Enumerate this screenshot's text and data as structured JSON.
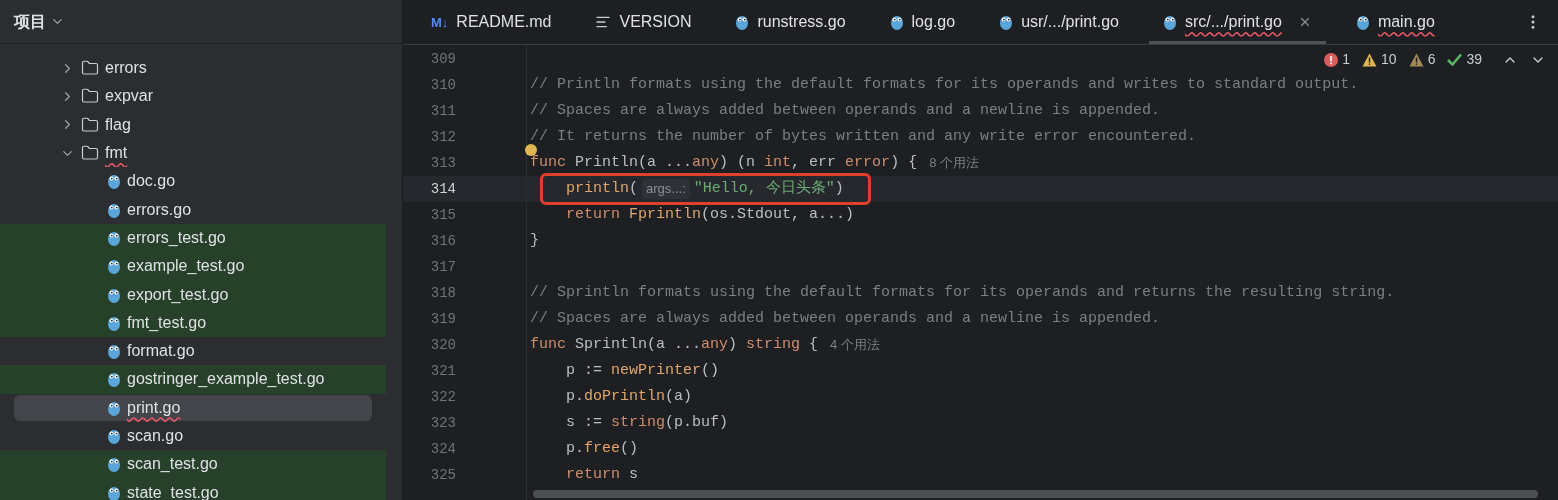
{
  "project_panel": {
    "title": "项目",
    "tree": [
      {
        "label": "errors",
        "kind": "folder",
        "expanded": false,
        "highlighted": false,
        "selected": false,
        "error": false
      },
      {
        "label": "expvar",
        "kind": "folder",
        "expanded": false,
        "highlighted": false,
        "selected": false,
        "error": false
      },
      {
        "label": "flag",
        "kind": "folder",
        "expanded": false,
        "highlighted": false,
        "selected": false,
        "error": false
      },
      {
        "label": "fmt",
        "kind": "folder",
        "expanded": true,
        "highlighted": false,
        "selected": false,
        "error": true,
        "children": [
          {
            "label": "doc.go",
            "kind": "go",
            "highlighted": false,
            "selected": false,
            "error": false
          },
          {
            "label": "errors.go",
            "kind": "go",
            "highlighted": false,
            "selected": false,
            "error": false
          },
          {
            "label": "errors_test.go",
            "kind": "go",
            "highlighted": true,
            "selected": false,
            "error": false
          },
          {
            "label": "example_test.go",
            "kind": "go",
            "highlighted": true,
            "selected": false,
            "error": false
          },
          {
            "label": "export_test.go",
            "kind": "go",
            "highlighted": true,
            "selected": false,
            "error": false
          },
          {
            "label": "fmt_test.go",
            "kind": "go",
            "highlighted": true,
            "selected": false,
            "error": false
          },
          {
            "label": "format.go",
            "kind": "go",
            "highlighted": false,
            "selected": false,
            "error": false
          },
          {
            "label": "gostringer_example_test.go",
            "kind": "go",
            "highlighted": true,
            "selected": false,
            "error": false
          },
          {
            "label": "print.go",
            "kind": "go",
            "highlighted": false,
            "selected": true,
            "error": true
          },
          {
            "label": "scan.go",
            "kind": "go",
            "highlighted": false,
            "selected": false,
            "error": false
          },
          {
            "label": "scan_test.go",
            "kind": "go",
            "highlighted": true,
            "selected": false,
            "error": false
          },
          {
            "label": "state_test.go",
            "kind": "go",
            "highlighted": true,
            "selected": false,
            "error": false
          }
        ]
      }
    ]
  },
  "tabs": [
    {
      "label": "README.md",
      "kind": "markdown",
      "badge": "M↓",
      "selected": false,
      "error": false
    },
    {
      "label": "VERSION",
      "kind": "text",
      "selected": false,
      "error": false
    },
    {
      "label": "runstress.go",
      "kind": "go",
      "selected": false,
      "error": false
    },
    {
      "label": "log.go",
      "kind": "go",
      "selected": false,
      "error": false
    },
    {
      "label": "usr/.../print.go",
      "kind": "go",
      "selected": false,
      "error": false
    },
    {
      "label": "src/.../print.go",
      "kind": "go",
      "selected": true,
      "error": true
    },
    {
      "label": "main.go",
      "kind": "go",
      "selected": false,
      "error": true
    }
  ],
  "inspections": [
    {
      "kind": "error",
      "count": "1"
    },
    {
      "kind": "warning",
      "count": "10"
    },
    {
      "kind": "weak",
      "count": "6"
    },
    {
      "kind": "ok",
      "count": "39"
    }
  ],
  "code": [
    {
      "number": "309",
      "current": false
    },
    {
      "number": "310",
      "current": false,
      "tokens": [
        {
          "text": "// Println formats using the default formats for its operands and writes to standard output.",
          "kind": "comment"
        }
      ]
    },
    {
      "number": "311",
      "current": false,
      "tokens": [
        {
          "text": "// Spaces are always added between operands and a newline is appended.",
          "kind": "comment"
        }
      ]
    },
    {
      "number": "312",
      "current": false,
      "tokens": [
        {
          "text": "// It returns the number of bytes written and any write error encountered.",
          "kind": "comment"
        }
      ]
    },
    {
      "number": "313",
      "current": false,
      "bulb": true,
      "tokens": [
        {
          "text": "func ",
          "kind": "keyword"
        },
        {
          "text": "Println",
          "kind": "decl"
        },
        {
          "text": "(a ...",
          "kind": "plain"
        },
        {
          "text": "any",
          "kind": "keyword"
        },
        {
          "text": ") (n ",
          "kind": "plain"
        },
        {
          "text": "int",
          "kind": "keyword"
        },
        {
          "text": ", err ",
          "kind": "plain"
        },
        {
          "text": "error",
          "kind": "keyword"
        },
        {
          "text": ") {",
          "kind": "plain"
        },
        {
          "text": "8 个用法",
          "kind": "usage"
        }
      ]
    },
    {
      "number": "314",
      "current": true,
      "boxed": true,
      "indented": true,
      "tokens": [
        {
          "text": "println",
          "kind": "call"
        },
        {
          "text": "(",
          "kind": "plain"
        },
        {
          "text": "args...:",
          "kind": "hint"
        },
        {
          "text": "\"Hello, 今日头条\"",
          "kind": "string"
        },
        {
          "text": ")",
          "kind": "plain"
        }
      ]
    },
    {
      "number": "315",
      "current": false,
      "indented": true,
      "tokens": [
        {
          "text": "return ",
          "kind": "keyword"
        },
        {
          "text": "Fprintln",
          "kind": "call"
        },
        {
          "text": "(os.Stdout, a...)",
          "kind": "plain"
        }
      ]
    },
    {
      "number": "316",
      "current": false,
      "tokens": [
        {
          "text": "}",
          "kind": "plain"
        }
      ]
    },
    {
      "number": "317",
      "current": false
    },
    {
      "number": "318",
      "current": false,
      "tokens": [
        {
          "text": "// Sprintln formats using the default formats for its operands and returns the resulting string.",
          "kind": "comment"
        }
      ]
    },
    {
      "number": "319",
      "current": false,
      "tokens": [
        {
          "text": "// Spaces are always added between operands and a newline is appended.",
          "kind": "comment"
        }
      ]
    },
    {
      "number": "320",
      "current": false,
      "tokens": [
        {
          "text": "func ",
          "kind": "keyword"
        },
        {
          "text": "Sprintln",
          "kind": "decl"
        },
        {
          "text": "(a ...",
          "kind": "plain"
        },
        {
          "text": "any",
          "kind": "keyword"
        },
        {
          "text": ") ",
          "kind": "plain"
        },
        {
          "text": "string",
          "kind": "keyword"
        },
        {
          "text": " {",
          "kind": "plain"
        },
        {
          "text": "4 个用法",
          "kind": "usage"
        }
      ]
    },
    {
      "number": "321",
      "current": false,
      "indented": true,
      "tokens": [
        {
          "text": "p := ",
          "kind": "plain"
        },
        {
          "text": "newPrinter",
          "kind": "call"
        },
        {
          "text": "()",
          "kind": "plain"
        }
      ]
    },
    {
      "number": "322",
      "current": false,
      "indented": true,
      "tokens": [
        {
          "text": "p.",
          "kind": "plain"
        },
        {
          "text": "doPrintln",
          "kind": "call"
        },
        {
          "text": "(a)",
          "kind": "plain"
        }
      ]
    },
    {
      "number": "323",
      "current": false,
      "indented": true,
      "tokens": [
        {
          "text": "s := ",
          "kind": "plain"
        },
        {
          "text": "string",
          "kind": "keyword"
        },
        {
          "text": "(p.buf)",
          "kind": "plain"
        }
      ]
    },
    {
      "number": "324",
      "current": false,
      "indented": true,
      "tokens": [
        {
          "text": "p.",
          "kind": "plain"
        },
        {
          "text": "free",
          "kind": "call"
        },
        {
          "text": "()",
          "kind": "plain"
        }
      ]
    },
    {
      "number": "325",
      "current": false,
      "indented": true,
      "tokens": [
        {
          "text": "return ",
          "kind": "keyword"
        },
        {
          "text": "s",
          "kind": "plain"
        }
      ]
    }
  ]
}
